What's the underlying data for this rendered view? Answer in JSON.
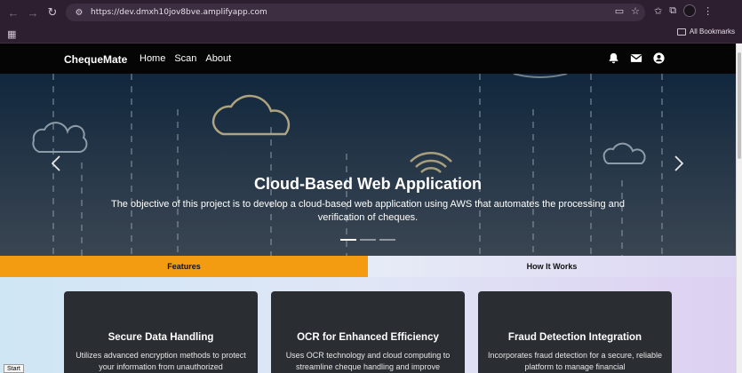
{
  "browser": {
    "url": "https://dev.dmxh10jov8bve.amplifyapp.com",
    "bookmarks_label": "All Bookmarks"
  },
  "navbar": {
    "brand": "ChequeMate",
    "links": [
      "Home",
      "Scan",
      "About"
    ]
  },
  "hero": {
    "title": "Cloud-Based Web Application",
    "description": "The objective of this project is to develop a cloud-based web application using AWS that automates the processing and verification of cheques.",
    "active_slide": 1,
    "slide_count": 3
  },
  "tabs": [
    {
      "label": "Features",
      "active": true
    },
    {
      "label": "How It Works",
      "active": false
    }
  ],
  "cards": [
    {
      "title": "Secure Data Handling",
      "text": "Utilizes advanced encryption methods to protect your information from unauthorized"
    },
    {
      "title": "OCR for Enhanced Efficiency",
      "text": "Uses OCR technology and cloud computing to streamline cheque handling and improve"
    },
    {
      "title": "Fraud Detection Integration",
      "text": "Incorporates fraud detection for a secure, reliable platform to manage financial"
    }
  ],
  "tooltip": "Start",
  "colors": {
    "accent": "#f39c12",
    "navbar": "#050505",
    "card": "#2a2d32"
  }
}
